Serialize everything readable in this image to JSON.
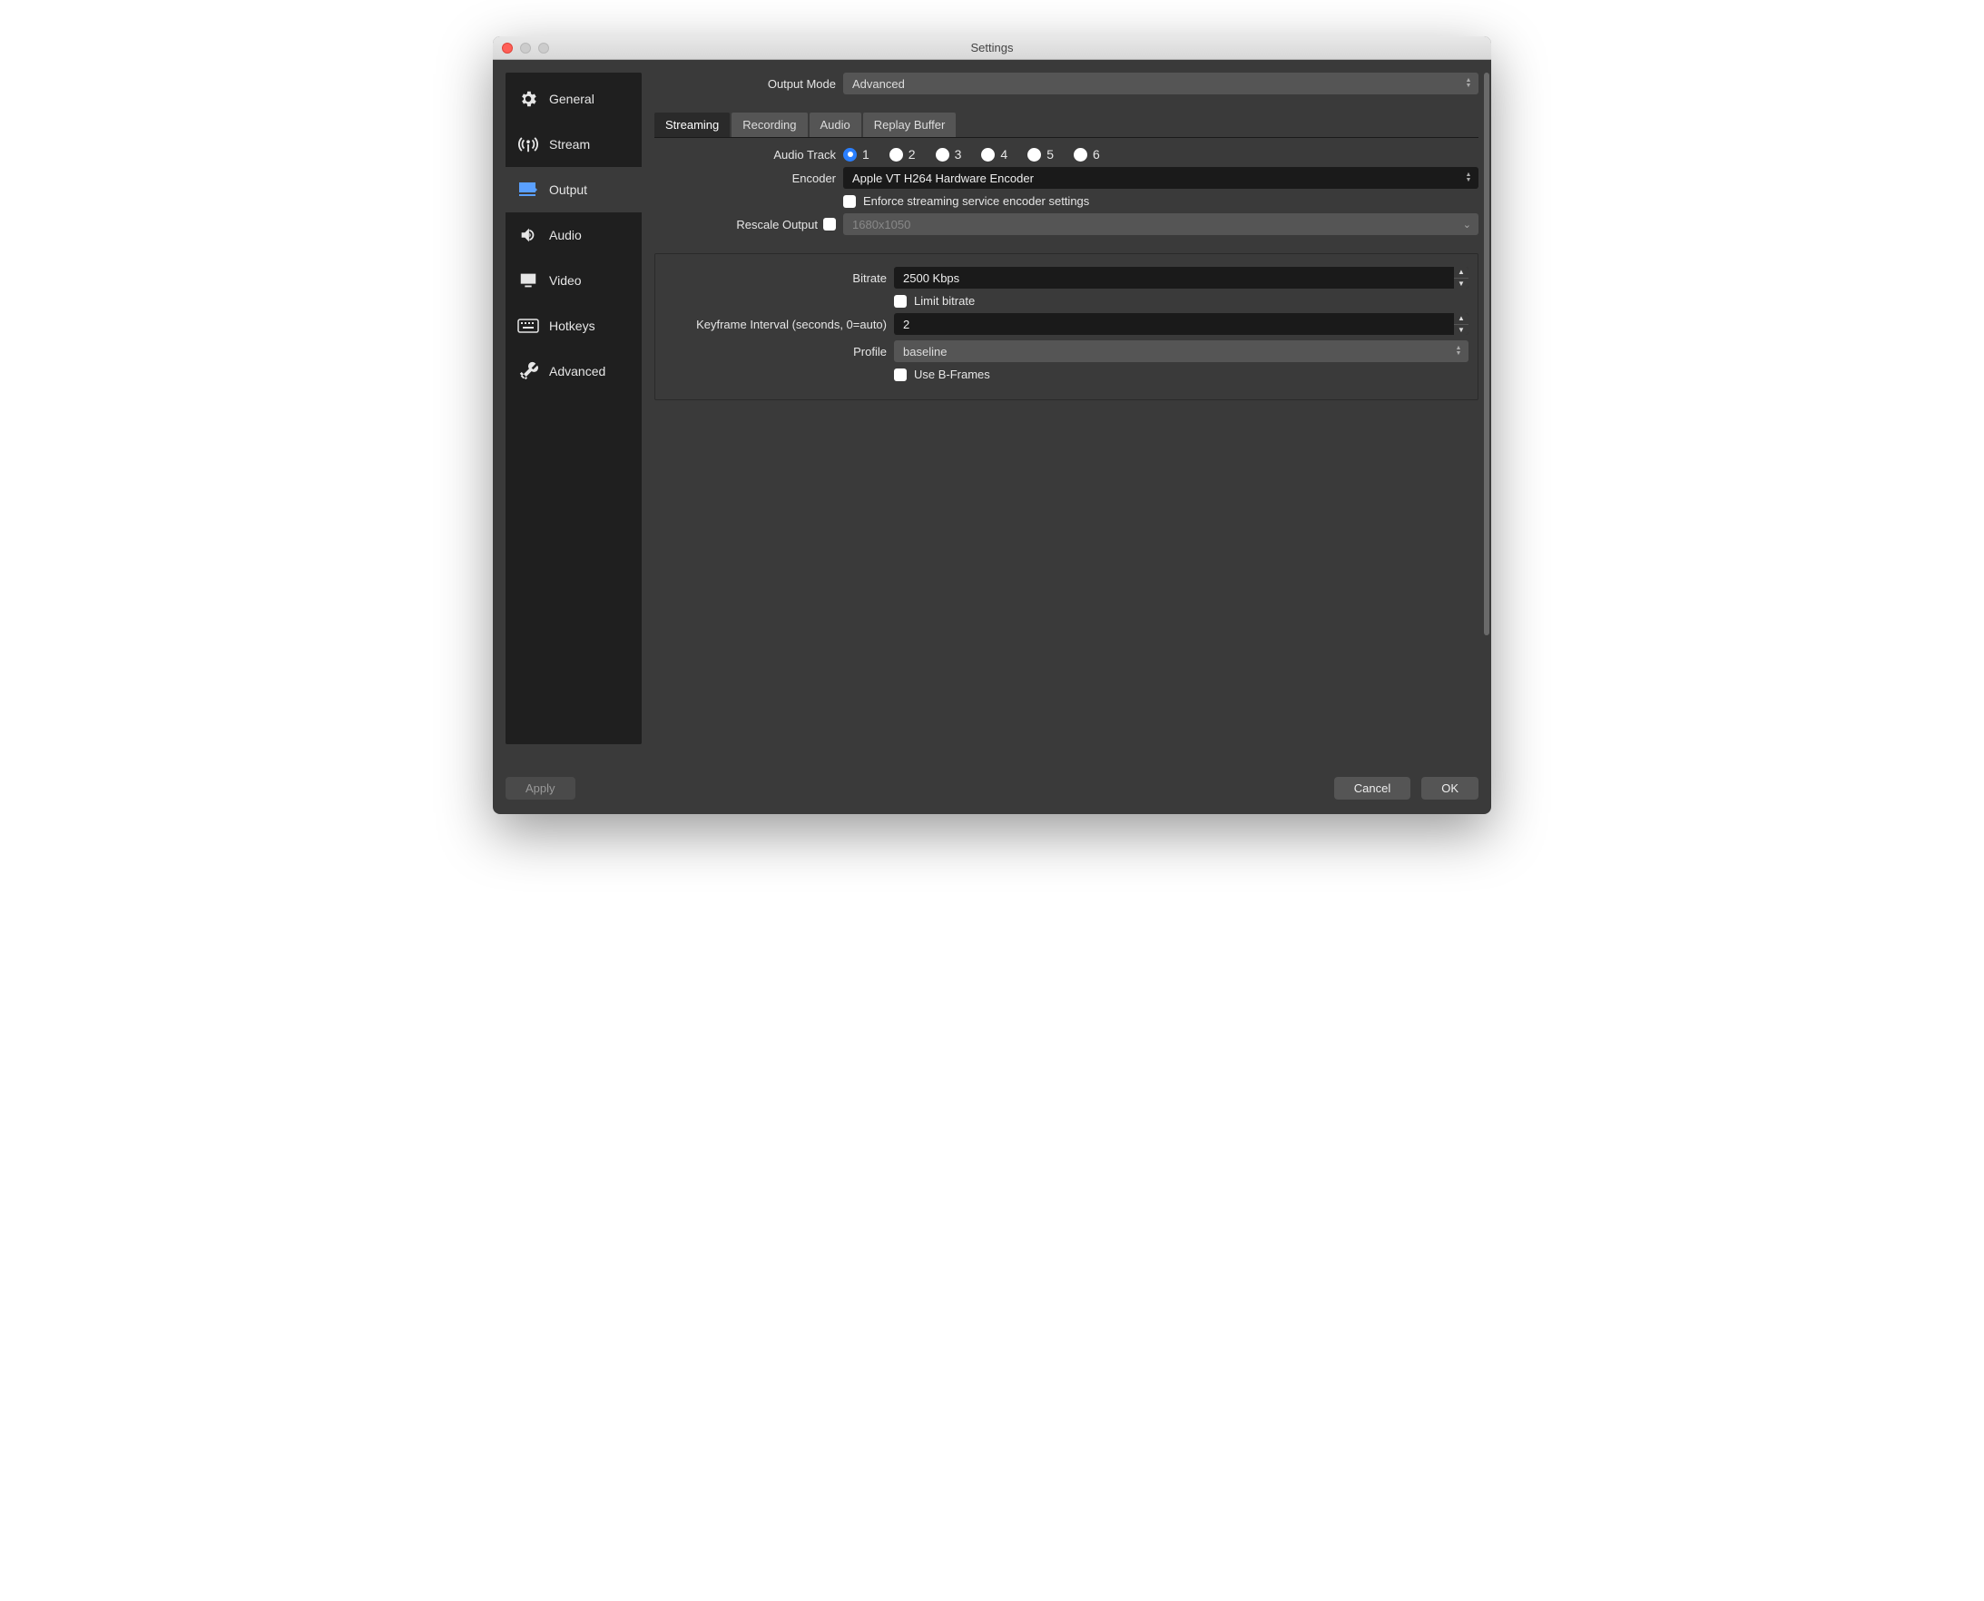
{
  "window": {
    "title": "Settings"
  },
  "sidebar": {
    "items": [
      {
        "label": "General"
      },
      {
        "label": "Stream"
      },
      {
        "label": "Output"
      },
      {
        "label": "Audio"
      },
      {
        "label": "Video"
      },
      {
        "label": "Hotkeys"
      },
      {
        "label": "Advanced"
      }
    ]
  },
  "output_mode": {
    "label": "Output Mode",
    "value": "Advanced"
  },
  "tabs": [
    {
      "label": "Streaming"
    },
    {
      "label": "Recording"
    },
    {
      "label": "Audio"
    },
    {
      "label": "Replay Buffer"
    }
  ],
  "streaming": {
    "audio_track": {
      "label": "Audio Track",
      "options": [
        "1",
        "2",
        "3",
        "4",
        "5",
        "6"
      ],
      "selected": "1"
    },
    "encoder": {
      "label": "Encoder",
      "value": "Apple VT H264 Hardware Encoder"
    },
    "enforce": {
      "label": "Enforce streaming service encoder settings",
      "checked": false
    },
    "rescale": {
      "label": "Rescale Output",
      "checked": false,
      "value": "1680x1050"
    },
    "bitrate": {
      "label": "Bitrate",
      "value": "2500 Kbps"
    },
    "limit_bitrate": {
      "label": "Limit bitrate",
      "checked": false
    },
    "keyframe": {
      "label": "Keyframe Interval (seconds, 0=auto)",
      "value": "2"
    },
    "profile": {
      "label": "Profile",
      "value": "baseline"
    },
    "bframes": {
      "label": "Use B-Frames",
      "checked": false
    }
  },
  "footer": {
    "apply": "Apply",
    "cancel": "Cancel",
    "ok": "OK"
  }
}
